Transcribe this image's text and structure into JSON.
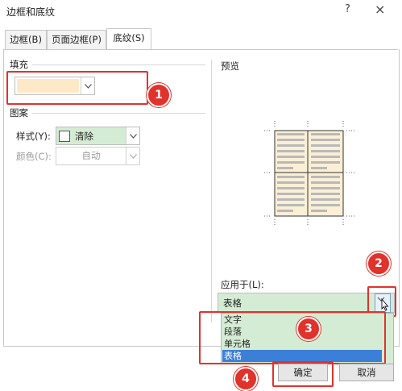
{
  "window": {
    "title": "边框和底纹",
    "help": "?",
    "close": "×"
  },
  "tabs": [
    {
      "label": "边框(B)"
    },
    {
      "label": "页面边框(P)"
    },
    {
      "label": "底纹(S)"
    }
  ],
  "fill": {
    "section": "填充",
    "value": "",
    "color": "#fde9c8"
  },
  "pattern": {
    "section": "图案",
    "style_label": "样式(Y):",
    "style_value": "清除",
    "color_label": "颜色(C):",
    "color_value": "自动"
  },
  "preview": {
    "label": "预览"
  },
  "apply": {
    "label": "应用于(L):",
    "value": "表格",
    "options": [
      "文字",
      "段落",
      "单元格",
      "表格"
    ],
    "selected": "表格"
  },
  "buttons": {
    "ok": "确定",
    "cancel": "取消"
  },
  "callouts": [
    "1",
    "2",
    "3",
    "4"
  ],
  "colors": {
    "accent_red": "#e0332c",
    "highlight_green": "#d5ecd4",
    "selection_blue": "#3c7fd8",
    "shading": "#fbefd6"
  }
}
